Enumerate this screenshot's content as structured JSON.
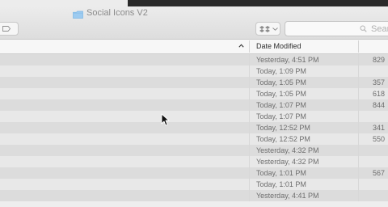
{
  "window": {
    "title": "Social Icons V2"
  },
  "toolbar": {
    "search_placeholder": "Sear"
  },
  "table": {
    "date_header": "Date Modified",
    "rows": [
      {
        "date": "Yesterday, 4:51 PM",
        "size": "829"
      },
      {
        "date": "Today, 1:09 PM",
        "size": ""
      },
      {
        "date": "Today, 1:05 PM",
        "size": "357"
      },
      {
        "date": "Today, 1:05 PM",
        "size": "618"
      },
      {
        "date": "Today, 1:07 PM",
        "size": "844"
      },
      {
        "date": "Today, 1:07 PM",
        "size": ""
      },
      {
        "date": "Today, 12:52 PM",
        "size": "341"
      },
      {
        "date": "Today, 12:52 PM",
        "size": "550"
      },
      {
        "date": "Yesterday, 4:32 PM",
        "size": ""
      },
      {
        "date": "Yesterday, 4:32 PM",
        "size": ""
      },
      {
        "date": "Today, 1:01 PM",
        "size": "567"
      },
      {
        "date": "Today, 1:01 PM",
        "size": ""
      },
      {
        "date": "Yesterday, 4:41 PM",
        "size": ""
      }
    ]
  },
  "icons": {
    "folder": "folder-icon",
    "tag": "tag-icon",
    "dropbox": "dropbox-icon",
    "chevron": "chevron-down-icon",
    "search": "search-icon",
    "sort": "sort-ascending-icon",
    "cursor": "mouse-pointer-icon"
  },
  "colors": {
    "folder": "#9dcbf0",
    "header_background": "#f7f7f7",
    "row_even": "#dcdcdc",
    "row_odd": "#e8e8e8"
  }
}
